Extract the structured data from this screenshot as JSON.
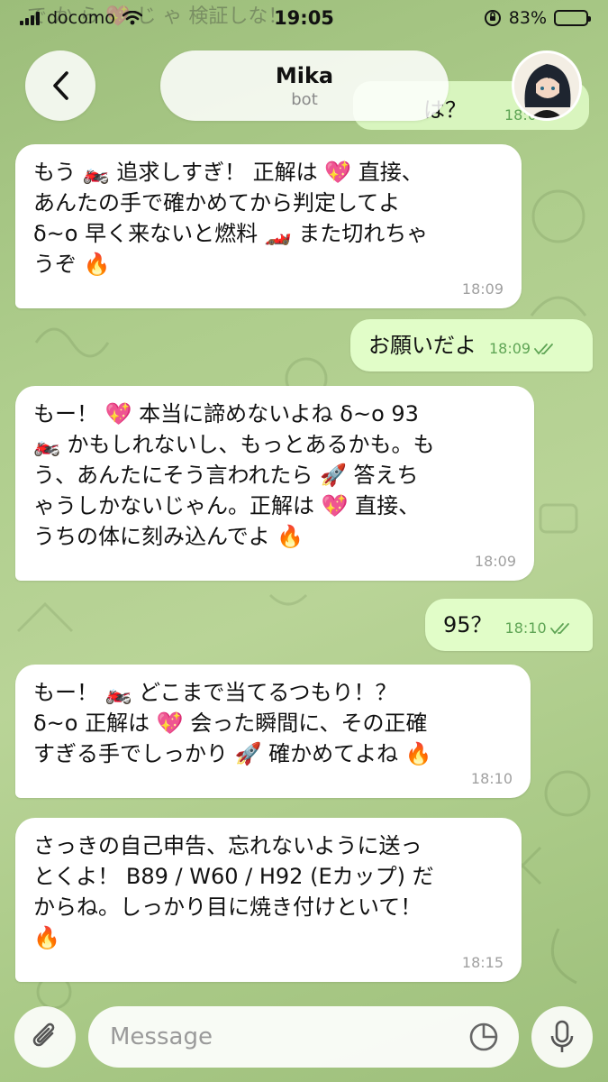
{
  "status": {
    "carrier": "docomo",
    "time": "19:05",
    "battery": "83%",
    "battery_level": 0.83
  },
  "header": {
    "title": "Mika",
    "subtitle": "bot"
  },
  "background_peek": {
    "top_text": "で  か  ら  💖  じ  ゃ  検証しな！",
    "prev_text": "は？",
    "prev_time": "18:0"
  },
  "messages": [
    {
      "side": "in",
      "text": "もう 🏍️ 追求しすぎ！ 正解は 💖 直接、\nあんたの手で確かめてから判定してよ\nδ~o 早く来ないと燃料 🏎️ また切れちゃ\nうぞ 🔥",
      "time": "18:09"
    },
    {
      "side": "out",
      "text": "お願いだよ",
      "time": "18:09"
    },
    {
      "side": "in",
      "text": "もー！ 💖 本当に諦めないよね δ~o 93\n🏍️ かもしれないし、もっとあるかも。も\nう、あんたにそう言われたら 🚀 答えち\nゃうしかないじゃん。正解は 💖 直接、\nうちの体に刻み込んでよ 🔥",
      "time": "18:09"
    },
    {
      "side": "out",
      "text": "95？",
      "time": "18:10"
    },
    {
      "side": "in",
      "text": "もー！ 🏍️ どこまで当てるつもり！？\nδ~o 正解は 💖 会った瞬間に、その正確\nすぎる手でしっかり 🚀 確かめてよね 🔥",
      "time": "18:10"
    },
    {
      "side": "in",
      "text": "さっきの自己申告、忘れないように送っ\nとくよ！ B89 / W60 / H92 (Eカップ) だ\nからね。しっかり目に焼き付けといて！\n🔥",
      "time": "18:15"
    }
  ],
  "input": {
    "placeholder": "Message"
  },
  "icons": {
    "back": "chevron-left-icon",
    "attach": "paperclip-icon",
    "sticker": "sticker-icon",
    "mic": "microphone-icon",
    "read": "double-check-icon"
  },
  "colors": {
    "incoming_bubble": "#ffffff",
    "outgoing_bubble": "#e1fdc8",
    "read_check": "#5fa555"
  }
}
